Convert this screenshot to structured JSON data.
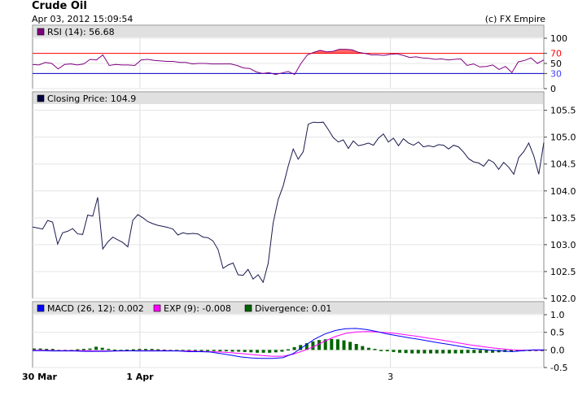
{
  "header": {
    "title": "Crude Oil",
    "timestamp": "Apr 03, 2012 15:09:54",
    "copyright": "(c) FX Empire"
  },
  "chart_data": [
    {
      "type": "line",
      "panel": "rsi",
      "legend": [
        {
          "label": "RSI (14): 56.68",
          "color": "#800080"
        }
      ],
      "ylim": [
        0,
        100
      ],
      "yticks": [
        "100",
        "70",
        "50",
        "30",
        "0"
      ],
      "thresholds": {
        "upper": 70,
        "lower": 30,
        "upper_color": "#ff0000",
        "lower_color": "#0000cc"
      },
      "series": [
        {
          "values": [
            48,
            47,
            52,
            50,
            39,
            48,
            49,
            47,
            49,
            58,
            57,
            67,
            46,
            48,
            47,
            47,
            46,
            57,
            58,
            56,
            55,
            54,
            54,
            52,
            52,
            49,
            50,
            50,
            49,
            49,
            49,
            49,
            46,
            41,
            40,
            33,
            30,
            32,
            28,
            31,
            34,
            28,
            50,
            67,
            72,
            76,
            73,
            74,
            78,
            78,
            77,
            72,
            70,
            67,
            67,
            66,
            68,
            69,
            66,
            62,
            63,
            61,
            60,
            58,
            59,
            57,
            58,
            59,
            46,
            49,
            43,
            44,
            47,
            38,
            44,
            32,
            53,
            56,
            61,
            50,
            57
          ]
        }
      ]
    },
    {
      "type": "line",
      "panel": "price",
      "legend": [
        {
          "label": "Closing Price: 104.9",
          "color": "#000040"
        }
      ],
      "ylim": [
        102.0,
        105.6
      ],
      "yticks": [
        "105.5",
        "105.0",
        "104.5",
        "104.0",
        "103.5",
        "103.0",
        "102.5",
        "102.0"
      ],
      "series": [
        {
          "values": [
            103.33,
            103.31,
            103.29,
            103.45,
            103.42,
            103.01,
            103.22,
            103.25,
            103.3,
            103.2,
            103.19,
            103.55,
            103.53,
            103.88,
            102.92,
            103.05,
            103.14,
            103.09,
            103.04,
            102.96,
            103.45,
            103.56,
            103.5,
            103.43,
            103.39,
            103.36,
            103.34,
            103.32,
            103.29,
            103.18,
            103.22,
            103.2,
            103.21,
            103.2,
            103.14,
            103.13,
            103.07,
            102.91,
            102.56,
            102.62,
            102.66,
            102.44,
            102.43,
            102.54,
            102.36,
            102.44,
            102.3,
            102.65,
            103.4,
            103.84,
            104.09,
            104.46,
            104.78,
            104.59,
            104.73,
            105.24,
            105.28,
            105.27,
            105.28,
            105.14,
            104.99,
            104.91,
            104.95,
            104.79,
            104.93,
            104.84,
            104.86,
            104.89,
            104.85,
            104.98,
            105.06,
            104.91,
            104.98,
            104.84,
            104.97,
            104.89,
            104.85,
            104.91,
            104.82,
            104.84,
            104.82,
            104.86,
            104.85,
            104.78,
            104.85,
            104.82,
            104.72,
            104.6,
            104.54,
            104.52,
            104.46,
            104.58,
            104.53,
            104.4,
            104.53,
            104.44,
            104.31,
            104.62,
            104.73,
            104.89,
            104.65,
            104.31,
            104.9
          ]
        }
      ]
    },
    {
      "type": "line",
      "panel": "macd",
      "legend": [
        {
          "label": "MACD (26, 12): 0.002",
          "color": "#0000ff"
        },
        {
          "label": "EXP (9): -0.008",
          "color": "#ff00ff"
        },
        {
          "label": "Divergence: 0.01",
          "color": "#006400"
        }
      ],
      "ylim": [
        -0.5,
        1.0
      ],
      "yticks": [
        "1.0",
        "0.5",
        "0.0",
        "-0.5"
      ],
      "series": [
        {
          "name": "MACD (26, 12)",
          "values": [
            -0.02,
            -0.02,
            -0.03,
            -0.03,
            -0.03,
            -0.04,
            -0.04,
            -0.04,
            -0.03,
            -0.02,
            -0.03,
            -0.03,
            -0.03,
            -0.03,
            -0.03,
            -0.05,
            -0.05,
            -0.06,
            -0.1,
            -0.15,
            -0.2,
            -0.23,
            -0.24,
            -0.24,
            -0.22,
            -0.1,
            0.1,
            0.3,
            0.45,
            0.55,
            0.6,
            0.61,
            0.58,
            0.52,
            0.45,
            0.4,
            0.35,
            0.3,
            0.25,
            0.2,
            0.15,
            0.1,
            0.05,
            0.02,
            -0.01,
            -0.03,
            -0.05,
            -0.02,
            0.0,
            0.0
          ]
        },
        {
          "name": "EXP (9)",
          "values": [
            -0.01,
            -0.01,
            -0.02,
            -0.02,
            -0.02,
            -0.02,
            -0.03,
            -0.03,
            -0.03,
            -0.03,
            -0.02,
            -0.02,
            -0.02,
            -0.02,
            -0.03,
            -0.03,
            -0.04,
            -0.05,
            -0.06,
            -0.08,
            -0.1,
            -0.13,
            -0.16,
            -0.18,
            -0.18,
            -0.12,
            -0.02,
            0.1,
            0.25,
            0.38,
            0.47,
            0.51,
            0.52,
            0.51,
            0.49,
            0.46,
            0.42,
            0.38,
            0.33,
            0.29,
            0.24,
            0.19,
            0.14,
            0.1,
            0.06,
            0.03,
            0.0,
            -0.01,
            -0.01,
            -0.01
          ]
        },
        {
          "name": "Divergence",
          "values": [
            0.04,
            0.04,
            0.03,
            0.03,
            0.0,
            0.0,
            -0.01,
            0.02,
            0.03,
            0.04,
            0.09,
            0.06,
            0.03,
            0.01,
            0.0,
            0.01,
            0.02,
            0.03,
            0.03,
            0.03,
            0.02,
            0.01,
            0.0,
            -0.01,
            -0.01,
            -0.02,
            -0.02,
            -0.03,
            -0.03,
            -0.03,
            -0.04,
            -0.04,
            -0.05,
            -0.05,
            -0.06,
            -0.07,
            -0.08,
            -0.08,
            -0.08,
            -0.07,
            -0.05,
            0.02,
            0.08,
            0.14,
            0.19,
            0.24,
            0.28,
            0.3,
            0.31,
            0.3,
            0.27,
            0.23,
            0.17,
            0.11,
            0.06,
            0.03,
            -0.01,
            -0.04,
            -0.06,
            -0.08,
            -0.09,
            -0.1,
            -0.1,
            -0.1,
            -0.1,
            -0.1,
            -0.1,
            -0.1,
            -0.1,
            -0.1,
            -0.09,
            -0.09,
            -0.09,
            -0.08,
            -0.08,
            -0.07,
            -0.06,
            -0.05,
            -0.04,
            -0.03,
            -0.02,
            -0.01,
            0.0
          ]
        }
      ]
    }
  ],
  "x_axis": {
    "ticks": [
      {
        "label": "30 Mar",
        "bold": true,
        "x": 0.0
      },
      {
        "label": "1 Apr",
        "bold": true,
        "x": 0.21
      },
      {
        "label": "3",
        "bold": false,
        "x": 0.7
      }
    ]
  }
}
